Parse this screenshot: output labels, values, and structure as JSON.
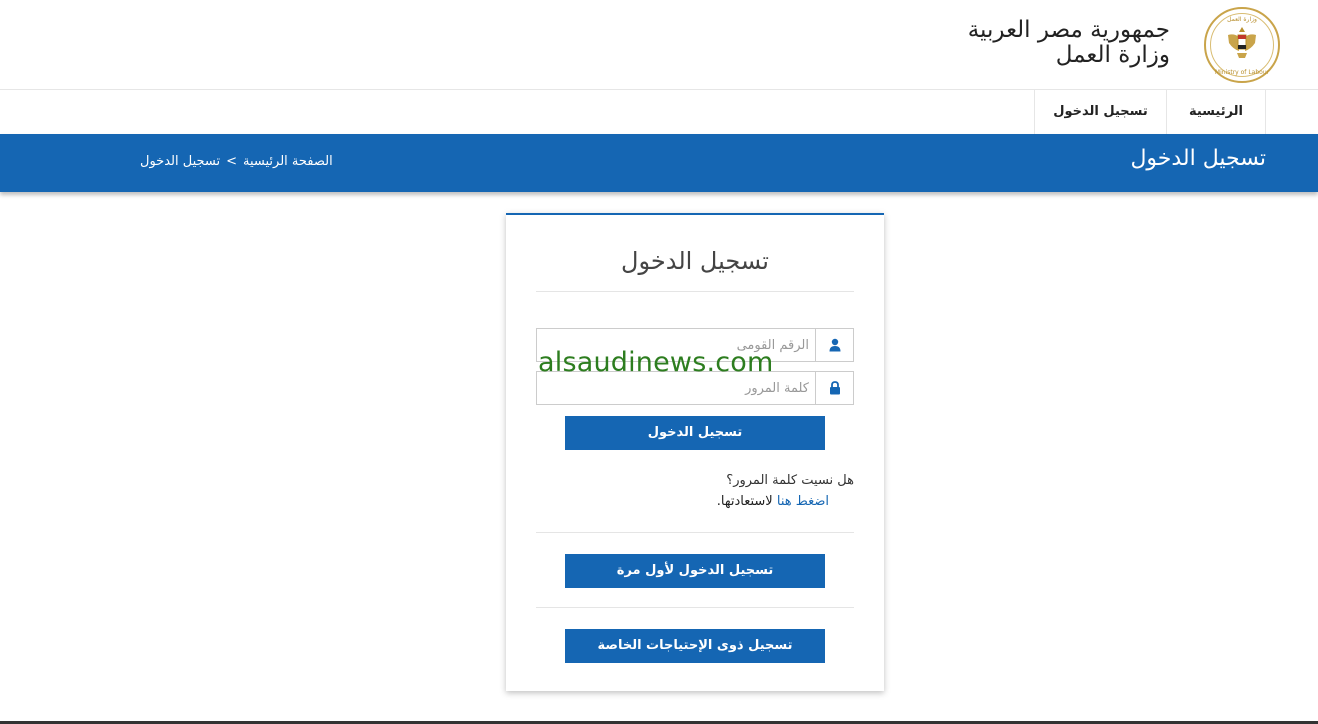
{
  "header": {
    "title_line1": "جمهورية مصر العربية",
    "title_line2": "وزارة العمل",
    "logo_text_top": "وزارة العمل",
    "logo_text_bottom": "Ministry of Labour"
  },
  "nav": {
    "items": [
      {
        "label": "الرئيسية"
      },
      {
        "label": "تسجيل الدخول"
      }
    ]
  },
  "banner": {
    "title": "تسجيل الدخول",
    "breadcrumb_home": "الصفحة الرئيسية",
    "breadcrumb_sep": ">",
    "breadcrumb_current": "تسجيل الدخول"
  },
  "login": {
    "title": "تسجيل الدخول",
    "national_id_placeholder": "الرقم القومى",
    "national_id_value": "",
    "password_placeholder": "كلمة المرور",
    "password_value": "",
    "submit_label": "تسجيل الدخول",
    "forgot_question": "هل نسيت كلمة المرور؟",
    "forgot_link": "اضغط هنا",
    "forgot_suffix": " لاستعادتها.",
    "first_login_label": "تسجيل الدخول لأول مرة",
    "special_needs_label": "تسجيل ذوى الإحتياجات الخاصة"
  },
  "watermark": "alsaudinews.com",
  "icons": {
    "logo": "egypt-eagle-emblem",
    "national_id_field": "user-icon",
    "password_field": "lock-icon"
  },
  "colors": {
    "primary": "#1566b3",
    "logo_gold": "#c9a44a",
    "watermark": "#2d7d1f"
  }
}
